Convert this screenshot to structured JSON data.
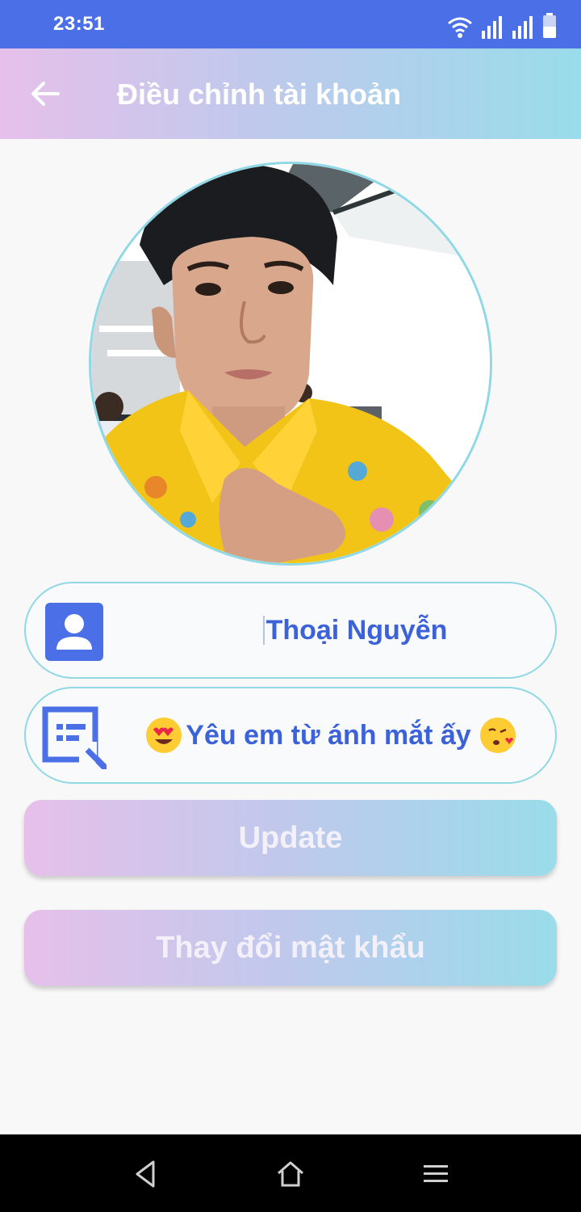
{
  "status_bar": {
    "time": "23:51",
    "icons": [
      "wifi-icon",
      "signal-icon",
      "signal-icon",
      "battery-icon"
    ]
  },
  "app_bar": {
    "title": "Điều chỉnh tài khoản",
    "back_icon": "arrow-left-icon"
  },
  "profile": {
    "name": "Thoại Nguyễn",
    "status_text": "Yêu em từ ánh mắt ấy",
    "status_emoji_left": "heart-eyes-emoji",
    "status_emoji_right": "kissing-heart-emoji"
  },
  "buttons": {
    "update_label": "Update",
    "change_password_label": "Thay đổi mật khẩu"
  },
  "colors": {
    "status_bar": "#4a6fe6",
    "accent_text": "#3b62d8",
    "gradient_start": "#e6c0ea",
    "gradient_end": "#99dcea",
    "border": "#90d8e4"
  },
  "nav_bar": {
    "icons": [
      "back-triangle-icon",
      "home-icon",
      "menu-icon"
    ]
  }
}
